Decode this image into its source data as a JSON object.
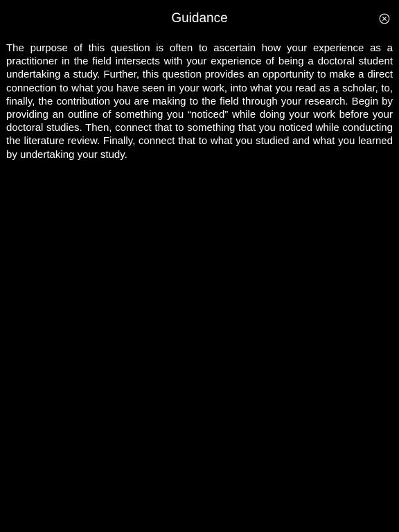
{
  "header": {
    "title": "Guidance",
    "close_icon": "close-circle-icon"
  },
  "guidance": {
    "text": "The purpose of this question is often to ascertain how your experience as a practitioner in the field intersects with your experience of being a doctoral student undertaking a study. Further, this question provides an opportunity to make a direct connection to what you have seen in your work, into what you read as a scholar, to, finally, the contribution you are making to the field through your research. Begin by providing an outline of something you “noticed” while doing your work before your doctoral studies. Then, connect that to something that you noticed while conducting the literature review. Finally, connect that to what you studied and what you learned by undertaking your study."
  },
  "colors": {
    "background": "#000000",
    "text": "#ffffff"
  }
}
